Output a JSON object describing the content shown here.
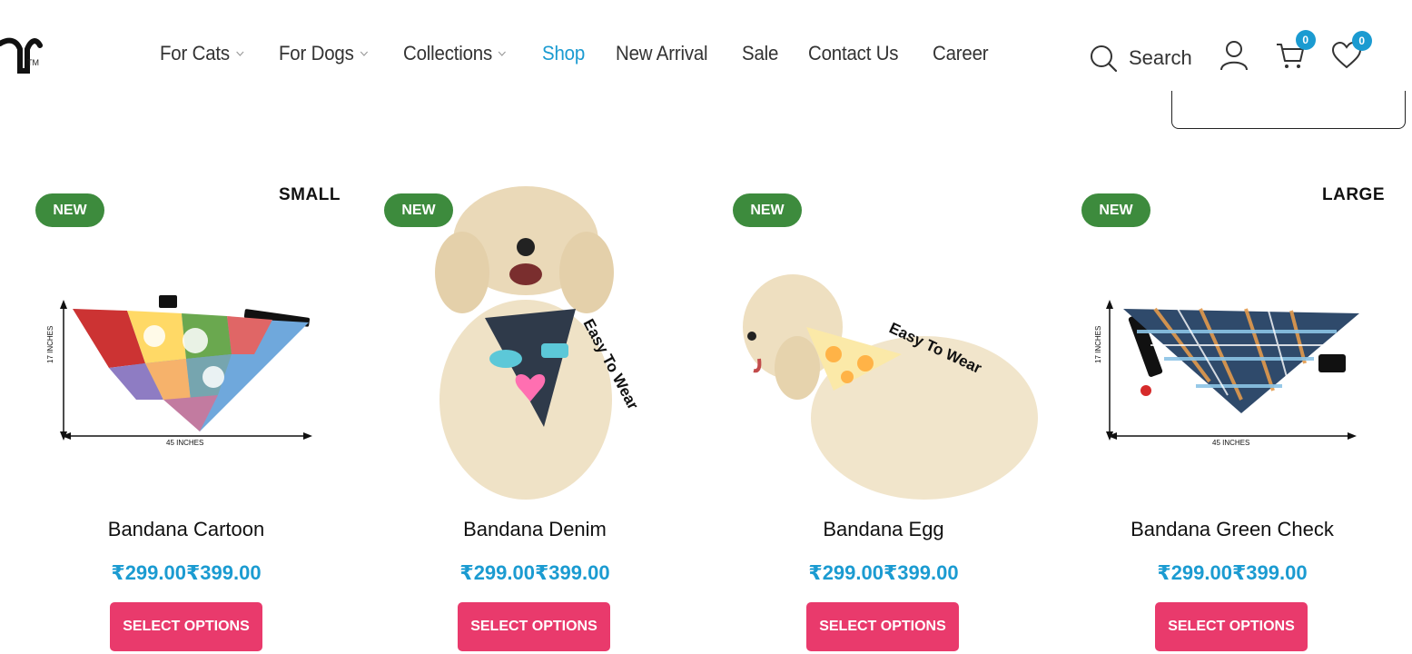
{
  "brand": {
    "trademark": "TM"
  },
  "nav": {
    "items": [
      {
        "label": "For Cats",
        "dropdown": true
      },
      {
        "label": "For Dogs",
        "dropdown": true
      },
      {
        "label": "Collections",
        "dropdown": true
      },
      {
        "label": "Shop",
        "dropdown": false,
        "active": true
      },
      {
        "label": "New Arrival",
        "dropdown": false
      },
      {
        "label": "Sale",
        "dropdown": false
      },
      {
        "label": "Contact Us",
        "dropdown": false
      },
      {
        "label": "Career",
        "dropdown": false
      }
    ]
  },
  "tools": {
    "search_label": "Search",
    "cart_count": "0",
    "wishlist_count": "0"
  },
  "colors": {
    "accent": "#1b9bd1",
    "badge_new": "#3d8b3d",
    "button": "#e93a6c"
  },
  "products": [
    {
      "badge": "NEW",
      "size_label": "SMALL",
      "image_caption_h": "45 INCHES",
      "image_caption_v": "17 INCHES",
      "name": "Bandana Cartoon",
      "price": "₹299.00₹399.00",
      "button": "SELECT OPTIONS"
    },
    {
      "badge": "NEW",
      "size_label": "",
      "image_caption": "Easy To Wear",
      "name": "Bandana Denim",
      "price": "₹299.00₹399.00",
      "button": "SELECT OPTIONS"
    },
    {
      "badge": "NEW",
      "size_label": "",
      "image_caption": "Easy To Wear",
      "name": "Bandana Egg",
      "price": "₹299.00₹399.00",
      "button": "SELECT OPTIONS"
    },
    {
      "badge": "NEW",
      "size_label": "LARGE",
      "image_caption_h": "45 INCHES",
      "image_caption_v": "17 INCHES",
      "name": "Bandana Green Check",
      "price": "₹299.00₹399.00",
      "button": "SELECT OPTIONS"
    }
  ]
}
